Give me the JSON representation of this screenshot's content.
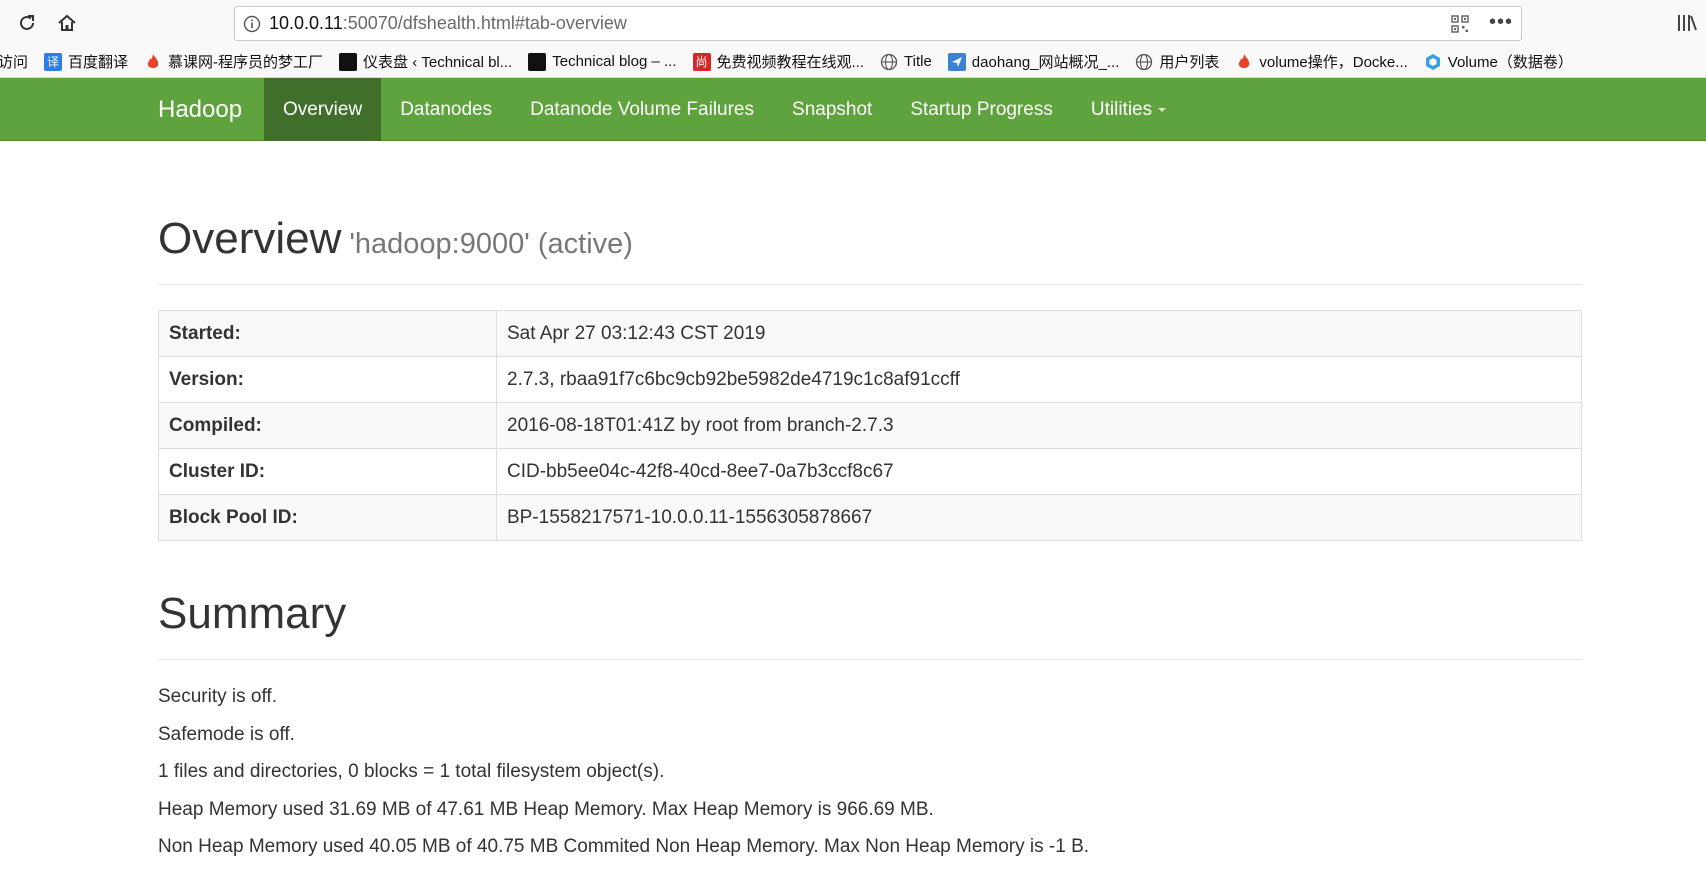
{
  "browser": {
    "url_host": "10.0.0.11",
    "url_rest": ":50070/dfshealth.html#tab-overview",
    "more_label": "•••",
    "bookmarks": [
      {
        "label": "访问",
        "icon": "none",
        "color": ""
      },
      {
        "label": "百度翻译",
        "icon": "translate-icon",
        "color": "#2b7de9"
      },
      {
        "label": "慕课网-程序员的梦工厂",
        "icon": "flame-icon",
        "color": "#e8412c"
      },
      {
        "label": "仪表盘 ‹ Technical bl...",
        "icon": "dashboard-icon",
        "color": "#111111"
      },
      {
        "label": "Technical blog – ...",
        "icon": "blog-icon",
        "color": "#111111"
      },
      {
        "label": "免费视频教程在线观...",
        "icon": "shang-icon",
        "color": "#d9262b"
      },
      {
        "label": "Title",
        "icon": "globe-icon",
        "color": "#555555"
      },
      {
        "label": "daohang_网站概况_...",
        "icon": "plane-icon",
        "color": "#3b82d6"
      },
      {
        "label": "用户列表",
        "icon": "globe-icon",
        "color": "#555555"
      },
      {
        "label": "volume操作，Docke...",
        "icon": "flame-icon",
        "color": "#e8412c"
      },
      {
        "label": "Volume（数据卷）",
        "icon": "cube-icon",
        "color": "#39a0e0"
      }
    ]
  },
  "navbar": {
    "brand": "Hadoop",
    "items": [
      {
        "label": "Overview",
        "active": true
      },
      {
        "label": "Datanodes",
        "active": false
      },
      {
        "label": "Datanode Volume Failures",
        "active": false
      },
      {
        "label": "Snapshot",
        "active": false
      },
      {
        "label": "Startup Progress",
        "active": false
      },
      {
        "label": "Utilities",
        "active": false,
        "dropdown": true
      }
    ],
    "colors": {
      "bar": "#5fa33e",
      "active": "#3f6f2a"
    }
  },
  "overview": {
    "title": "Overview",
    "subtitle": "'hadoop:9000' (active)",
    "rows": [
      {
        "key": "Started:",
        "value": "Sat Apr 27 03:12:43 CST 2019"
      },
      {
        "key": "Version:",
        "value": "2.7.3, rbaa91f7c6bc9cb92be5982de4719c1c8af91ccff"
      },
      {
        "key": "Compiled:",
        "value": "2016-08-18T01:41Z by root from branch-2.7.3"
      },
      {
        "key": "Cluster ID:",
        "value": "CID-bb5ee04c-42f8-40cd-8ee7-0a7b3ccf8c67"
      },
      {
        "key": "Block Pool ID:",
        "value": "BP-1558217571-10.0.0.11-1556305878667"
      }
    ]
  },
  "summary": {
    "title": "Summary",
    "lines": [
      "Security is off.",
      "Safemode is off.",
      "1 files and directories, 0 blocks = 1 total filesystem object(s).",
      "Heap Memory used 31.69 MB of 47.61 MB Heap Memory. Max Heap Memory is 966.69 MB.",
      "Non Heap Memory used 40.05 MB of 40.75 MB Commited Non Heap Memory. Max Non Heap Memory is -1 B."
    ]
  }
}
